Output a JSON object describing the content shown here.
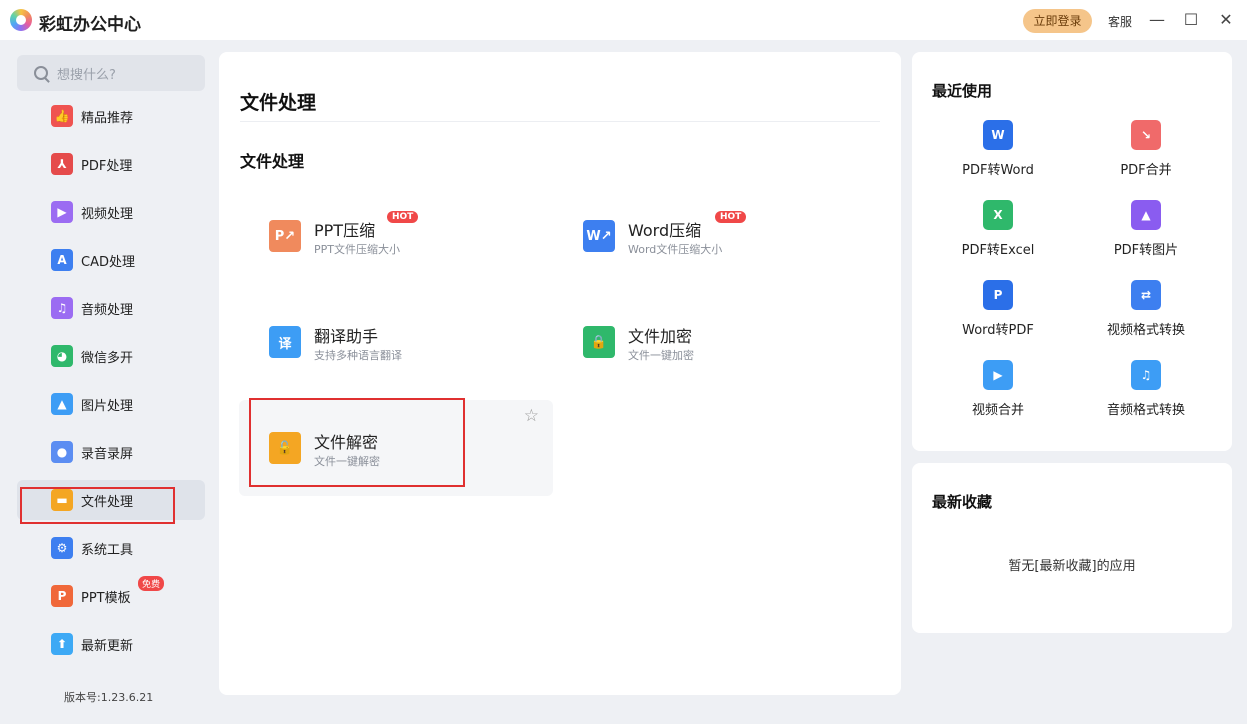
{
  "app": {
    "title": "彩虹办公中心",
    "login_label": "立即登录",
    "service_label": "客服"
  },
  "search": {
    "placeholder": "想搜什么?"
  },
  "sidebar": {
    "items": [
      {
        "label": "精品推荐",
        "icon": "thumbs-up-icon",
        "color": "#ef5350"
      },
      {
        "label": "PDF处理",
        "icon": "pdf-icon",
        "color": "#e54b4b"
      },
      {
        "label": "视频处理",
        "icon": "play-icon",
        "color": "#9b6cf2"
      },
      {
        "label": "CAD处理",
        "icon": "cad-icon",
        "color": "#3d7ff0"
      },
      {
        "label": "音频处理",
        "icon": "music-icon",
        "color": "#9b6cf2"
      },
      {
        "label": "微信多开",
        "icon": "wechat-icon",
        "color": "#2fb86b"
      },
      {
        "label": "图片处理",
        "icon": "image-icon",
        "color": "#3d9df5"
      },
      {
        "label": "录音录屏",
        "icon": "mic-icon",
        "color": "#5b8df2"
      },
      {
        "label": "文件处理",
        "icon": "folder-icon",
        "color": "#f4a623"
      },
      {
        "label": "系统工具",
        "icon": "gear-icon",
        "color": "#3d7ff0"
      },
      {
        "label": "PPT模板",
        "icon": "ppt-icon",
        "color": "#f0683a",
        "badge": "免费"
      },
      {
        "label": "最新更新",
        "icon": "upload-icon",
        "color": "#3da9f5"
      }
    ],
    "version": "版本号:1.23.6.21"
  },
  "main": {
    "title": "文件处理",
    "section_title": "文件处理",
    "tools": [
      {
        "name": "PPT压缩",
        "desc": "PPT文件压缩大小",
        "hot": "HOT",
        "icon": "ppt-compress-icon",
        "color": "#f08a5d"
      },
      {
        "name": "Word压缩",
        "desc": "Word文件压缩大小",
        "hot": "HOT",
        "icon": "word-compress-icon",
        "color": "#3d7ff0"
      },
      {
        "name": "翻译助手",
        "desc": "支持多种语言翻译",
        "icon": "translate-icon",
        "color": "#3d9df5"
      },
      {
        "name": "文件加密",
        "desc": "文件一键加密",
        "icon": "file-lock-icon",
        "color": "#2fb86b"
      },
      {
        "name": "文件解密",
        "desc": "文件一键解密",
        "icon": "file-unlock-icon",
        "color": "#f4a623"
      }
    ]
  },
  "recent": {
    "title": "最近使用",
    "apps": [
      {
        "label": "PDF转Word",
        "icon": "pdf-to-word-icon",
        "color": "#2b6fe8",
        "glyph": "W"
      },
      {
        "label": "PDF合并",
        "icon": "pdf-merge-icon",
        "color": "#f06a6a",
        "glyph": "↘"
      },
      {
        "label": "PDF转Excel",
        "icon": "pdf-to-excel-icon",
        "color": "#2fb86b",
        "glyph": "X"
      },
      {
        "label": "PDF转图片",
        "icon": "pdf-to-image-icon",
        "color": "#8a5cf0",
        "glyph": "▲"
      },
      {
        "label": "Word转PDF",
        "icon": "word-to-pdf-icon",
        "color": "#2b6fe8",
        "glyph": "P"
      },
      {
        "label": "视频格式转换",
        "icon": "video-convert-icon",
        "color": "#3d7ff0",
        "glyph": "⇄"
      },
      {
        "label": "视频合并",
        "icon": "video-merge-icon",
        "color": "#3d9df5",
        "glyph": "▶"
      },
      {
        "label": "音频格式转换",
        "icon": "audio-convert-icon",
        "color": "#3d9df5",
        "glyph": "♫"
      }
    ]
  },
  "favorites": {
    "title": "最新收藏",
    "empty_text": "暂无[最新收藏]的应用"
  }
}
